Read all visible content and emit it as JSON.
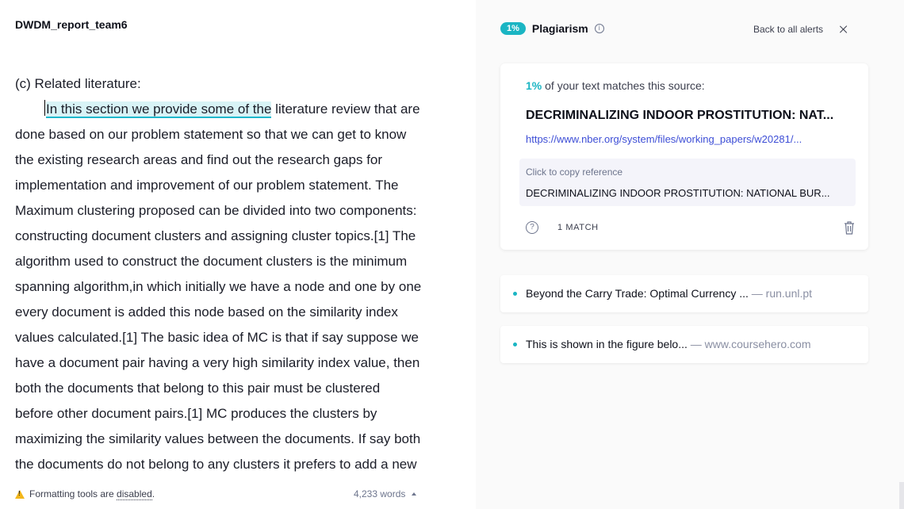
{
  "document": {
    "title": "DWDM_report_team6",
    "heading": "(c) Related literature:",
    "highlighted": "In this section we provide some of the",
    "first_line_rest": " literature review that are",
    "lines": [
      "done based on our problem statement so that we can get to know",
      "the existing research areas and find out the research gaps for",
      "implementation and improvement of our problem statement. The",
      "Maximum clustering proposed can be divided into two components:",
      "constructing document clusters and assigning cluster topics.[1] The",
      "algorithm used to construct the document clusters is the minimum",
      "spanning algorithm,in which initially we have a node and one by one",
      "every document is added this node based on the similarity index",
      "values calculated.[1] The basic idea of MC is that if say suppose we",
      "have a document pair having  a very high similarity index value, then",
      "both the documents that belong to this pair must be clustered",
      "before other document pairs.[1] MC produces the clusters by",
      "maximizing the similarity values between the documents. If say both",
      "the documents do not belong to any clusters it prefers to add a new"
    ]
  },
  "footer": {
    "warning_prefix": "Formatting tools are ",
    "warning_link": "disabled",
    "warning_suffix": ".",
    "word_count": "4,233 words"
  },
  "panel": {
    "badge": "1%",
    "title": "Plagiarism",
    "back_label": "Back to all alerts",
    "card": {
      "pct": "1%",
      "match_text": " of your text matches this source:",
      "source_title": "DECRIMINALIZING INDOOR PROSTITUTION: NAT...",
      "source_url": "https://www.nber.org/system/files/working_papers/w20281/...",
      "copy_hint": "Click to copy reference",
      "reference": "DECRIMINALIZING INDOOR PROSTITUTION: NATIONAL BUR...",
      "match_count": "1 MATCH"
    },
    "other_sources": [
      {
        "text": "Beyond the Carry Trade: Optimal Currency ...",
        "source": " — run.unl.pt"
      },
      {
        "text": "This is shown in the figure belo...",
        "source": " — www.coursehero.com"
      }
    ]
  },
  "colors": {
    "accent": "#1ab5c3",
    "highlight_bg": "#d8f3f6",
    "link": "#3d4ed6",
    "warning": "#f3b71b"
  }
}
